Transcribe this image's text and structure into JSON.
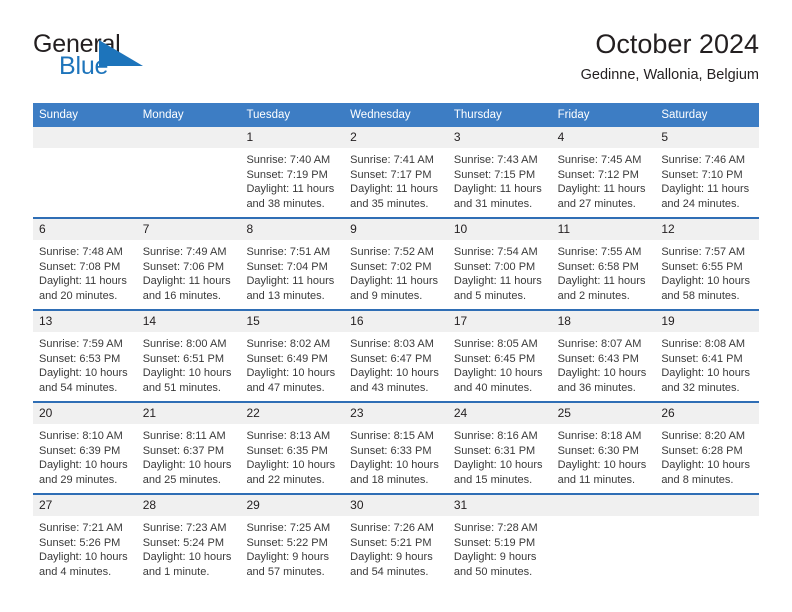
{
  "brand": {
    "name_part1": "General",
    "name_part2": "Blue",
    "triangle_icon": "triangle-icon",
    "blue": "#1d74bb"
  },
  "header": {
    "title": "October 2024",
    "subtitle": "Gedinne, Wallonia, Belgium"
  },
  "theme": {
    "header_blue": "#3d7dc4",
    "row_rule_blue": "#2f6eb5",
    "daynum_band": "#f0f0f0"
  },
  "calendar": {
    "weekday_headers": [
      "Sunday",
      "Monday",
      "Tuesday",
      "Wednesday",
      "Thursday",
      "Friday",
      "Saturday"
    ],
    "labels": {
      "sunrise": "Sunrise:",
      "sunset": "Sunset:",
      "daylight": "Daylight:"
    },
    "weeks": [
      [
        {
          "day": "",
          "empty": true
        },
        {
          "day": "",
          "empty": true
        },
        {
          "day": "1",
          "sunrise": "Sunrise: 7:40 AM",
          "sunset": "Sunset: 7:19 PM",
          "daylight_line1": "Daylight: 11 hours",
          "daylight_line2": "and 38 minutes."
        },
        {
          "day": "2",
          "sunrise": "Sunrise: 7:41 AM",
          "sunset": "Sunset: 7:17 PM",
          "daylight_line1": "Daylight: 11 hours",
          "daylight_line2": "and 35 minutes."
        },
        {
          "day": "3",
          "sunrise": "Sunrise: 7:43 AM",
          "sunset": "Sunset: 7:15 PM",
          "daylight_line1": "Daylight: 11 hours",
          "daylight_line2": "and 31 minutes."
        },
        {
          "day": "4",
          "sunrise": "Sunrise: 7:45 AM",
          "sunset": "Sunset: 7:12 PM",
          "daylight_line1": "Daylight: 11 hours",
          "daylight_line2": "and 27 minutes."
        },
        {
          "day": "5",
          "sunrise": "Sunrise: 7:46 AM",
          "sunset": "Sunset: 7:10 PM",
          "daylight_line1": "Daylight: 11 hours",
          "daylight_line2": "and 24 minutes."
        }
      ],
      [
        {
          "day": "6",
          "sunrise": "Sunrise: 7:48 AM",
          "sunset": "Sunset: 7:08 PM",
          "daylight_line1": "Daylight: 11 hours",
          "daylight_line2": "and 20 minutes."
        },
        {
          "day": "7",
          "sunrise": "Sunrise: 7:49 AM",
          "sunset": "Sunset: 7:06 PM",
          "daylight_line1": "Daylight: 11 hours",
          "daylight_line2": "and 16 minutes."
        },
        {
          "day": "8",
          "sunrise": "Sunrise: 7:51 AM",
          "sunset": "Sunset: 7:04 PM",
          "daylight_line1": "Daylight: 11 hours",
          "daylight_line2": "and 13 minutes."
        },
        {
          "day": "9",
          "sunrise": "Sunrise: 7:52 AM",
          "sunset": "Sunset: 7:02 PM",
          "daylight_line1": "Daylight: 11 hours",
          "daylight_line2": "and 9 minutes."
        },
        {
          "day": "10",
          "sunrise": "Sunrise: 7:54 AM",
          "sunset": "Sunset: 7:00 PM",
          "daylight_line1": "Daylight: 11 hours",
          "daylight_line2": "and 5 minutes."
        },
        {
          "day": "11",
          "sunrise": "Sunrise: 7:55 AM",
          "sunset": "Sunset: 6:58 PM",
          "daylight_line1": "Daylight: 11 hours",
          "daylight_line2": "and 2 minutes."
        },
        {
          "day": "12",
          "sunrise": "Sunrise: 7:57 AM",
          "sunset": "Sunset: 6:55 PM",
          "daylight_line1": "Daylight: 10 hours",
          "daylight_line2": "and 58 minutes."
        }
      ],
      [
        {
          "day": "13",
          "sunrise": "Sunrise: 7:59 AM",
          "sunset": "Sunset: 6:53 PM",
          "daylight_line1": "Daylight: 10 hours",
          "daylight_line2": "and 54 minutes."
        },
        {
          "day": "14",
          "sunrise": "Sunrise: 8:00 AM",
          "sunset": "Sunset: 6:51 PM",
          "daylight_line1": "Daylight: 10 hours",
          "daylight_line2": "and 51 minutes."
        },
        {
          "day": "15",
          "sunrise": "Sunrise: 8:02 AM",
          "sunset": "Sunset: 6:49 PM",
          "daylight_line1": "Daylight: 10 hours",
          "daylight_line2": "and 47 minutes."
        },
        {
          "day": "16",
          "sunrise": "Sunrise: 8:03 AM",
          "sunset": "Sunset: 6:47 PM",
          "daylight_line1": "Daylight: 10 hours",
          "daylight_line2": "and 43 minutes."
        },
        {
          "day": "17",
          "sunrise": "Sunrise: 8:05 AM",
          "sunset": "Sunset: 6:45 PM",
          "daylight_line1": "Daylight: 10 hours",
          "daylight_line2": "and 40 minutes."
        },
        {
          "day": "18",
          "sunrise": "Sunrise: 8:07 AM",
          "sunset": "Sunset: 6:43 PM",
          "daylight_line1": "Daylight: 10 hours",
          "daylight_line2": "and 36 minutes."
        },
        {
          "day": "19",
          "sunrise": "Sunrise: 8:08 AM",
          "sunset": "Sunset: 6:41 PM",
          "daylight_line1": "Daylight: 10 hours",
          "daylight_line2": "and 32 minutes."
        }
      ],
      [
        {
          "day": "20",
          "sunrise": "Sunrise: 8:10 AM",
          "sunset": "Sunset: 6:39 PM",
          "daylight_line1": "Daylight: 10 hours",
          "daylight_line2": "and 29 minutes."
        },
        {
          "day": "21",
          "sunrise": "Sunrise: 8:11 AM",
          "sunset": "Sunset: 6:37 PM",
          "daylight_line1": "Daylight: 10 hours",
          "daylight_line2": "and 25 minutes."
        },
        {
          "day": "22",
          "sunrise": "Sunrise: 8:13 AM",
          "sunset": "Sunset: 6:35 PM",
          "daylight_line1": "Daylight: 10 hours",
          "daylight_line2": "and 22 minutes."
        },
        {
          "day": "23",
          "sunrise": "Sunrise: 8:15 AM",
          "sunset": "Sunset: 6:33 PM",
          "daylight_line1": "Daylight: 10 hours",
          "daylight_line2": "and 18 minutes."
        },
        {
          "day": "24",
          "sunrise": "Sunrise: 8:16 AM",
          "sunset": "Sunset: 6:31 PM",
          "daylight_line1": "Daylight: 10 hours",
          "daylight_line2": "and 15 minutes."
        },
        {
          "day": "25",
          "sunrise": "Sunrise: 8:18 AM",
          "sunset": "Sunset: 6:30 PM",
          "daylight_line1": "Daylight: 10 hours",
          "daylight_line2": "and 11 minutes."
        },
        {
          "day": "26",
          "sunrise": "Sunrise: 8:20 AM",
          "sunset": "Sunset: 6:28 PM",
          "daylight_line1": "Daylight: 10 hours",
          "daylight_line2": "and 8 minutes."
        }
      ],
      [
        {
          "day": "27",
          "sunrise": "Sunrise: 7:21 AM",
          "sunset": "Sunset: 5:26 PM",
          "daylight_line1": "Daylight: 10 hours",
          "daylight_line2": "and 4 minutes."
        },
        {
          "day": "28",
          "sunrise": "Sunrise: 7:23 AM",
          "sunset": "Sunset: 5:24 PM",
          "daylight_line1": "Daylight: 10 hours",
          "daylight_line2": "and 1 minute."
        },
        {
          "day": "29",
          "sunrise": "Sunrise: 7:25 AM",
          "sunset": "Sunset: 5:22 PM",
          "daylight_line1": "Daylight: 9 hours",
          "daylight_line2": "and 57 minutes."
        },
        {
          "day": "30",
          "sunrise": "Sunrise: 7:26 AM",
          "sunset": "Sunset: 5:21 PM",
          "daylight_line1": "Daylight: 9 hours",
          "daylight_line2": "and 54 minutes."
        },
        {
          "day": "31",
          "sunrise": "Sunrise: 7:28 AM",
          "sunset": "Sunset: 5:19 PM",
          "daylight_line1": "Daylight: 9 hours",
          "daylight_line2": "and 50 minutes."
        },
        {
          "day": "",
          "empty": true
        },
        {
          "day": "",
          "empty": true
        }
      ]
    ]
  }
}
